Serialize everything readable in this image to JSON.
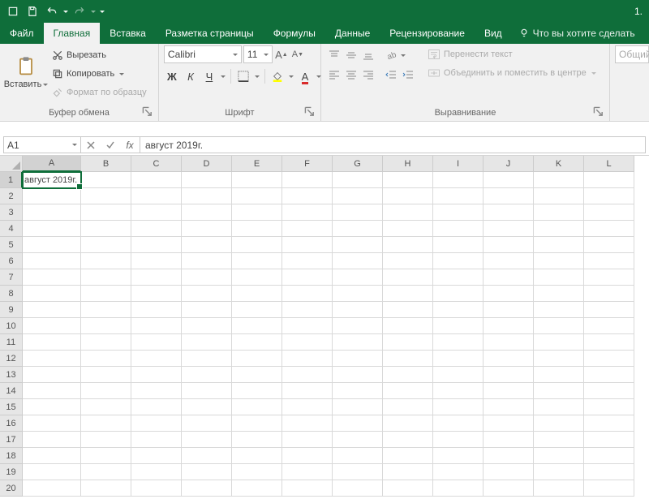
{
  "titlebar": {
    "title": "1."
  },
  "tabs": {
    "file": "Файл",
    "home": "Главная",
    "insert": "Вставка",
    "pagelayout": "Разметка страницы",
    "formulas": "Формулы",
    "data": "Данные",
    "review": "Рецензирование",
    "view": "Вид",
    "tellme": "Что вы хотите сделать"
  },
  "ribbon": {
    "clipboard": {
      "paste": "Вставить",
      "cut": "Вырезать",
      "copy": "Копировать",
      "formatpainter": "Формат по образцу",
      "group_label": "Буфер обмена"
    },
    "font": {
      "name": "Calibri",
      "size": "11",
      "bold": "Ж",
      "italic": "К",
      "underline": "Ч",
      "group_label": "Шрифт"
    },
    "align": {
      "wrap": "Перенести текст",
      "merge": "Объединить и поместить в центре",
      "group_label": "Выравнивание"
    },
    "number": {
      "format": "Общий"
    }
  },
  "formula_bar": {
    "namebox": "A1",
    "fx": "fx",
    "value": "август 2019г."
  },
  "grid": {
    "cols": [
      "A",
      "B",
      "C",
      "D",
      "E",
      "F",
      "G",
      "H",
      "I",
      "J",
      "K",
      "L"
    ],
    "rows": [
      "1",
      "2",
      "3",
      "4",
      "5",
      "6",
      "7",
      "8",
      "9",
      "10",
      "11",
      "12",
      "13",
      "14",
      "15",
      "16",
      "17",
      "18",
      "19",
      "20"
    ],
    "a1": "август 2019г."
  }
}
